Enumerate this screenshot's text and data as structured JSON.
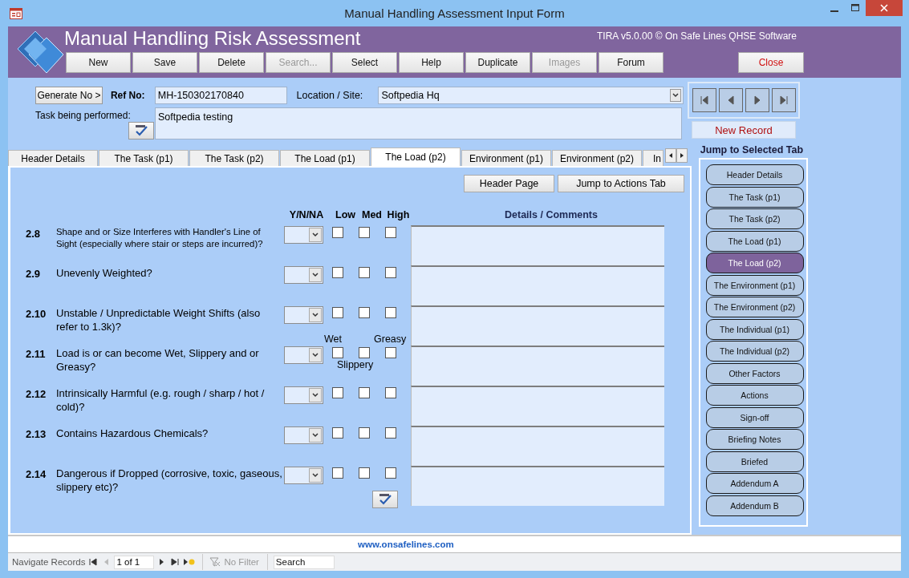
{
  "window": {
    "title": "Manual Handling Assessment Input Form"
  },
  "header": {
    "title": "Manual Handling Risk Assessment",
    "version": "TIRA v5.0.00 © On Safe Lines QHSE Software"
  },
  "toolbar": [
    {
      "label": "New",
      "disabled": false,
      "kind": "command"
    },
    {
      "label": "Save",
      "disabled": false,
      "kind": "command"
    },
    {
      "label": "Delete",
      "disabled": false,
      "kind": "command"
    },
    {
      "label": "Search...",
      "disabled": true,
      "kind": "command"
    },
    {
      "label": "Select",
      "disabled": false,
      "kind": "command"
    },
    {
      "label": "Help",
      "disabled": false,
      "kind": "command"
    },
    {
      "label": "Duplicate",
      "disabled": false,
      "kind": "command"
    },
    {
      "label": "Images",
      "disabled": true,
      "kind": "command"
    },
    {
      "label": "Forum",
      "disabled": false,
      "kind": "command"
    },
    {
      "label": "Close",
      "disabled": false,
      "kind": "close"
    }
  ],
  "record": {
    "generate_button": "Generate No >",
    "ref_label": "Ref No:",
    "ref_value": "MH-150302170840",
    "location_label": "Location / Site:",
    "location_value": "Softpedia Hq",
    "task_label": "Task being performed:",
    "task_value": "Softpedia testing",
    "status": "New Record"
  },
  "tabs": [
    {
      "label": "Header Details",
      "selected": false
    },
    {
      "label": "The Task (p1)",
      "selected": false
    },
    {
      "label": "The Task (p2)",
      "selected": false
    },
    {
      "label": "The Load (p1)",
      "selected": false
    },
    {
      "label": "The Load (p2)",
      "selected": true
    },
    {
      "label": "Environment (p1)",
      "selected": false
    },
    {
      "label": "Environment (p2)",
      "selected": false
    },
    {
      "label": "In",
      "selected": false
    }
  ],
  "panel": {
    "buttons": [
      "Header Page",
      "Jump to Actions Tab"
    ],
    "columns": [
      "Y/N/NA",
      "Low",
      "Med",
      "High",
      "Details / Comments"
    ],
    "rows": [
      {
        "number": "2.8",
        "question": "Shape and or Size Interferes with Handler's Line of Sight (especially where stair or steps are incurred)?",
        "kind": "risk",
        "checks": [
          false,
          false,
          false
        ]
      },
      {
        "number": "2.9",
        "question": "Unevenly Weighted?",
        "kind": "risk",
        "checks": [
          false,
          false,
          false
        ]
      },
      {
        "number": "2.10",
        "question": "Unstable / Unpredictable Weight Shifts (also refer to 1.3k)?",
        "kind": "risk",
        "checks": [
          false,
          false,
          false
        ]
      },
      {
        "number": "2.11",
        "question": "Load is or can become Wet, Slippery and or Greasy?",
        "kind": "condition",
        "options": [
          "Wet",
          "Slippery",
          "Greasy"
        ],
        "checks": [
          false,
          false,
          false
        ]
      },
      {
        "number": "2.12",
        "question": "Intrinsically Harmful (e.g. rough / sharp / hot / cold)?",
        "kind": "risk",
        "checks": [
          false,
          false,
          false
        ]
      },
      {
        "number": "2.13",
        "question": "Contains Hazardous Chemicals?",
        "kind": "risk",
        "checks": [
          false,
          false,
          false
        ]
      },
      {
        "number": "2.14",
        "question": "Dangerous if Dropped (corrosive, toxic, gaseous, slippery etc)?",
        "kind": "risk",
        "checks": [
          false,
          false,
          false
        ]
      }
    ]
  },
  "jump": {
    "title": "Jump to Selected Tab",
    "items": [
      {
        "label": "Header Details",
        "selected": false
      },
      {
        "label": "The Task (p1)",
        "selected": false
      },
      {
        "label": "The Task (p2)",
        "selected": false
      },
      {
        "label": "The Load (p1)",
        "selected": false
      },
      {
        "label": "The Load (p2)",
        "selected": true
      },
      {
        "label": "The Environment (p1)",
        "selected": false
      },
      {
        "label": "The Environment (p2)",
        "selected": false
      },
      {
        "label": "The Individual (p1)",
        "selected": false
      },
      {
        "label": "The Individual (p2)",
        "selected": false
      },
      {
        "label": "Other Factors",
        "selected": false
      },
      {
        "label": "Actions",
        "selected": false
      },
      {
        "label": "Sign-off",
        "selected": false
      },
      {
        "label": "Briefing Notes",
        "selected": false
      },
      {
        "label": "Briefed",
        "selected": false
      },
      {
        "label": "Addendum A",
        "selected": false
      },
      {
        "label": "Addendum B",
        "selected": false
      }
    ]
  },
  "footer": {
    "url": "www.onsafelines.com"
  },
  "status_bar": {
    "label": "Navigate Records",
    "position": "1 of 1",
    "filter": "No Filter",
    "search": {
      "placeholder": "Search"
    }
  }
}
